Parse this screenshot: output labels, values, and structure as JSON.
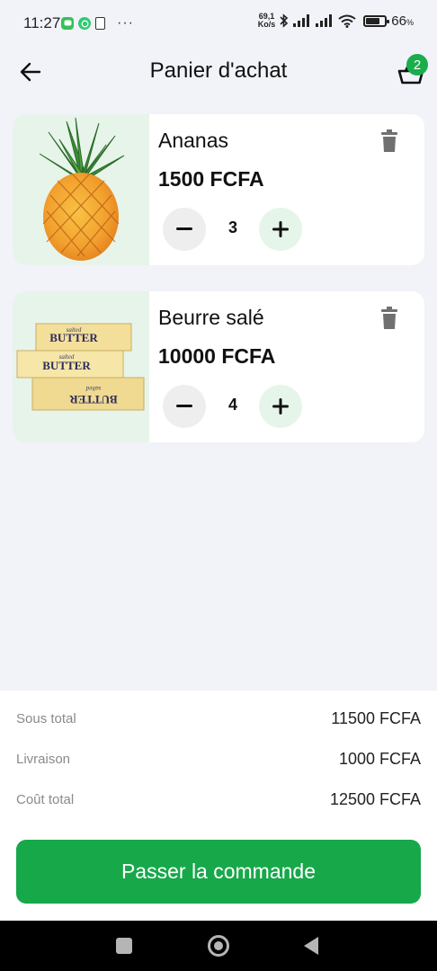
{
  "status_bar": {
    "time": "11:27",
    "net_speed_value": "69,1",
    "net_speed_unit": "Ko/s",
    "battery_pct": "66",
    "battery_unit": "%",
    "battery_level": 0.66,
    "more_dots": "···"
  },
  "header": {
    "title": "Panier d'achat",
    "cart_count": "2"
  },
  "items": [
    {
      "name": "Ananas",
      "price": "1500 FCFA",
      "quantity": "3",
      "image": "pineapple"
    },
    {
      "name": "Beurre salé",
      "price": "10000 FCFA",
      "quantity": "4",
      "image": "salted-butter",
      "image_text": [
        "salted",
        "BUTTER"
      ]
    }
  ],
  "summary": {
    "subtotal_label": "Sous total",
    "subtotal_value": "11500 FCFA",
    "delivery_label": "Livraison",
    "delivery_value": "1000 FCFA",
    "total_label": "Coût total",
    "total_value": "12500 FCFA"
  },
  "checkout_label": "Passer la commande",
  "colors": {
    "accent": "#17a84a",
    "image_bg": "#e7f4ea",
    "page_bg": "#f1f3f8"
  }
}
